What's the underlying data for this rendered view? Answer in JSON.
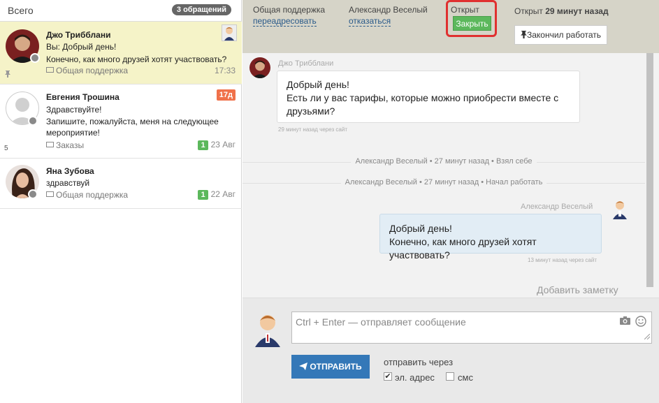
{
  "left": {
    "title": "Всего",
    "count_badge": "3 обращений",
    "tickets": [
      {
        "name": "Джо Трибблани",
        "lines": [
          "Вы: Добрый день!",
          "Конечно, как много друзей хотят участвовать?"
        ],
        "queue": "Общая поддержка",
        "time": "17:33",
        "active": true
      },
      {
        "name": "Евгения Трошина",
        "lines": [
          "Здравствуйте!",
          "Запишите, пожалуйста, меня на следующее",
          "мероприятие!"
        ],
        "queue": "Заказы",
        "unread": "1",
        "date": "23 Авг",
        "age_badge": "17д",
        "side_number": "5"
      },
      {
        "name": "Яна Зубова",
        "lines": [
          "здравствуй"
        ],
        "queue": "Общая поддержка",
        "unread": "1",
        "date": "22 Авг"
      }
    ]
  },
  "topbar": {
    "queue_label": "Общая поддержка",
    "queue_action": "переадресовать",
    "agent_label": "Александр Веселый",
    "agent_action": "отказаться",
    "status_label": "Открыт",
    "close_button": "Закрыть",
    "opened_prefix": "Открыт",
    "opened_ago": "29 минут назад",
    "finish_button": "Закончил работать"
  },
  "messages": {
    "first": {
      "author": "Джо Трибблани",
      "lines": [
        "Добрый день!",
        "Есть ли у вас тарифы, которые можно приобрести вместе с",
        "друзьями?"
      ],
      "meta": "29 минут назад через сайт"
    },
    "events": [
      "Александр Веселый • 27 минут назад • Взял себе",
      "Александр Веселый • 27 минут назад • Начал работать"
    ],
    "reply": {
      "author": "Александр Веселый",
      "lines": [
        "Добрый день!",
        "Конечно, как много друзей хотят участвовать?"
      ],
      "meta": "13 минут назад через сайт"
    },
    "add_note": "Добавить заметку"
  },
  "composer": {
    "placeholder": "Ctrl + Enter — отправляет сообщение",
    "send_button": "ОТПРАВИТЬ",
    "send_via": "отправить через",
    "option_email": "эл. адрес",
    "option_sms": "смс",
    "email_checked": true,
    "sms_checked": false
  },
  "colors": {
    "active_ticket": "#f5f3c8",
    "topbar": "#d6d4c8",
    "close_button": "#5cb85c",
    "highlight_border": "#e03030",
    "send_button": "#3478b8",
    "age_badge": "#f0714a"
  }
}
